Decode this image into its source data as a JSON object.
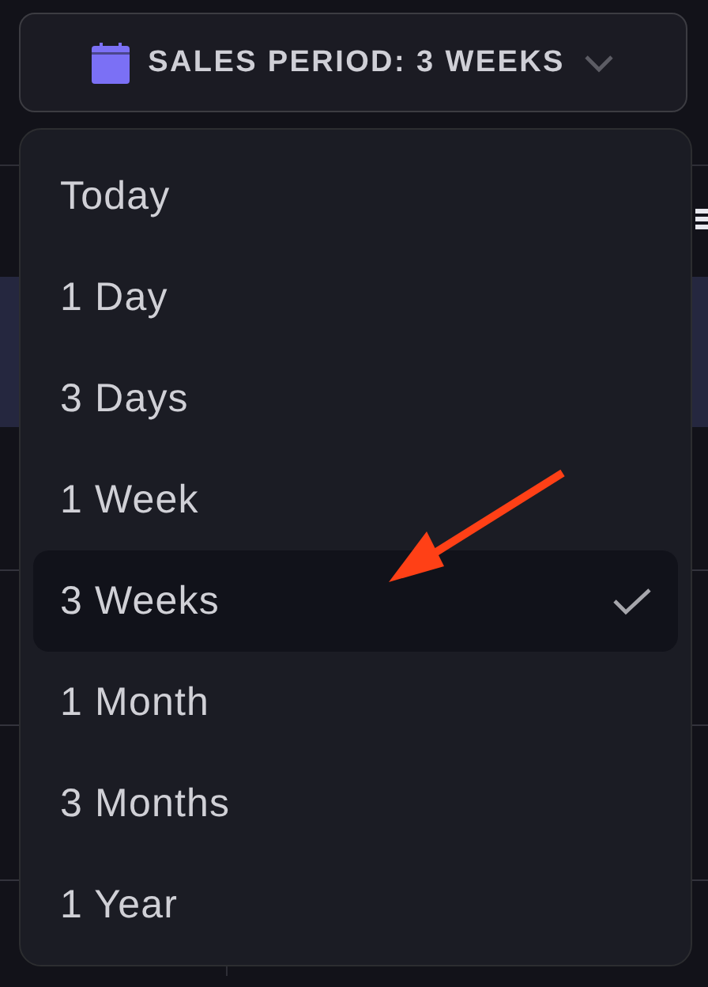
{
  "period_button": {
    "label": "SALES PERIOD: 3 WEEKS"
  },
  "period_menu": {
    "items": [
      {
        "label": "Today",
        "selected": false
      },
      {
        "label": "1 Day",
        "selected": false
      },
      {
        "label": "3 Days",
        "selected": false
      },
      {
        "label": "1 Week",
        "selected": false
      },
      {
        "label": "3 Weeks",
        "selected": true
      },
      {
        "label": "1 Month",
        "selected": false
      },
      {
        "label": "3 Months",
        "selected": false
      },
      {
        "label": "1 Year",
        "selected": false
      }
    ]
  }
}
